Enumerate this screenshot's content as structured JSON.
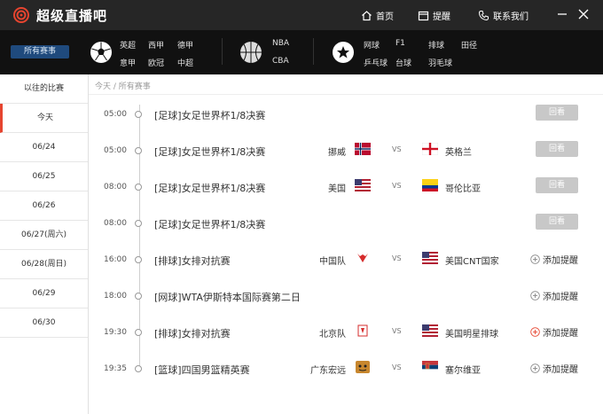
{
  "app": {
    "title": "超级直播吧",
    "accent": "#e6442f"
  },
  "topbar": {
    "home": "首页",
    "reminder": "提醒",
    "contact": "联系我们"
  },
  "categories": {
    "all": "所有赛事",
    "football": [
      "英超",
      "西甲",
      "德甲",
      "意甲",
      "欧冠",
      "中超"
    ],
    "basketball": [
      "NBA",
      "CBA"
    ],
    "other": [
      "网球",
      "F1",
      "排球",
      "田径",
      "乒乓球",
      "台球",
      "羽毛球"
    ]
  },
  "sidebar": {
    "items": [
      "以往的比赛",
      "今天",
      "06/24",
      "06/25",
      "06/26",
      "06/27(周六)",
      "06/28(周日)",
      "06/29",
      "06/30"
    ],
    "active_index": 1
  },
  "breadcrumb": [
    "今天",
    "所有赛事"
  ],
  "matches": [
    {
      "time": "05:00",
      "title": "[足球]女足世界杯1/8决赛",
      "team1": "",
      "team2": "",
      "vs": "",
      "action": "replay",
      "action_label": "回看",
      "flag1": "",
      "flag2": ""
    },
    {
      "time": "05:00",
      "title": "[足球]女足世界杯1/8决赛",
      "team1": "挪威",
      "team2": "英格兰",
      "vs": "VS",
      "action": "replay",
      "action_label": "回看",
      "flag1": "norway",
      "flag2": "england"
    },
    {
      "time": "08:00",
      "title": "[足球]女足世界杯1/8决赛",
      "team1": "美国",
      "team2": "哥伦比亚",
      "vs": "VS",
      "action": "replay",
      "action_label": "回看",
      "flag1": "usa",
      "flag2": "colombia"
    },
    {
      "time": "08:00",
      "title": "[足球]女足世界杯1/8决赛",
      "team1": "",
      "team2": "",
      "vs": "",
      "action": "replay",
      "action_label": "回看",
      "flag1": "",
      "flag2": ""
    },
    {
      "time": "16:00",
      "title": "[排球]女排对抗赛",
      "team1": "中国队",
      "team2": "美国CNT国家",
      "vs": "VS",
      "action": "remind",
      "action_label": "添加提醒",
      "flag1": "china-team",
      "flag2": "usa"
    },
    {
      "time": "18:00",
      "title": "[网球]WTA伊斯特本国际赛第二日",
      "team1": "",
      "team2": "",
      "vs": "",
      "action": "remind",
      "action_label": "添加提醒",
      "flag1": "",
      "flag2": ""
    },
    {
      "time": "19:30",
      "title": "[排球]女排对抗赛",
      "team1": "北京队",
      "team2": "美国明星排球",
      "vs": "VS",
      "action": "remind",
      "action_label": "添加提醒",
      "flag1": "beijing",
      "flag2": "usa"
    },
    {
      "time": "19:35",
      "title": "[篮球]四国男篮精英赛",
      "team1": "广东宏远",
      "team2": "塞尔维亚",
      "vs": "VS",
      "action": "remind",
      "action_label": "添加提醒",
      "flag1": "guangdong",
      "flag2": "serbia"
    }
  ]
}
